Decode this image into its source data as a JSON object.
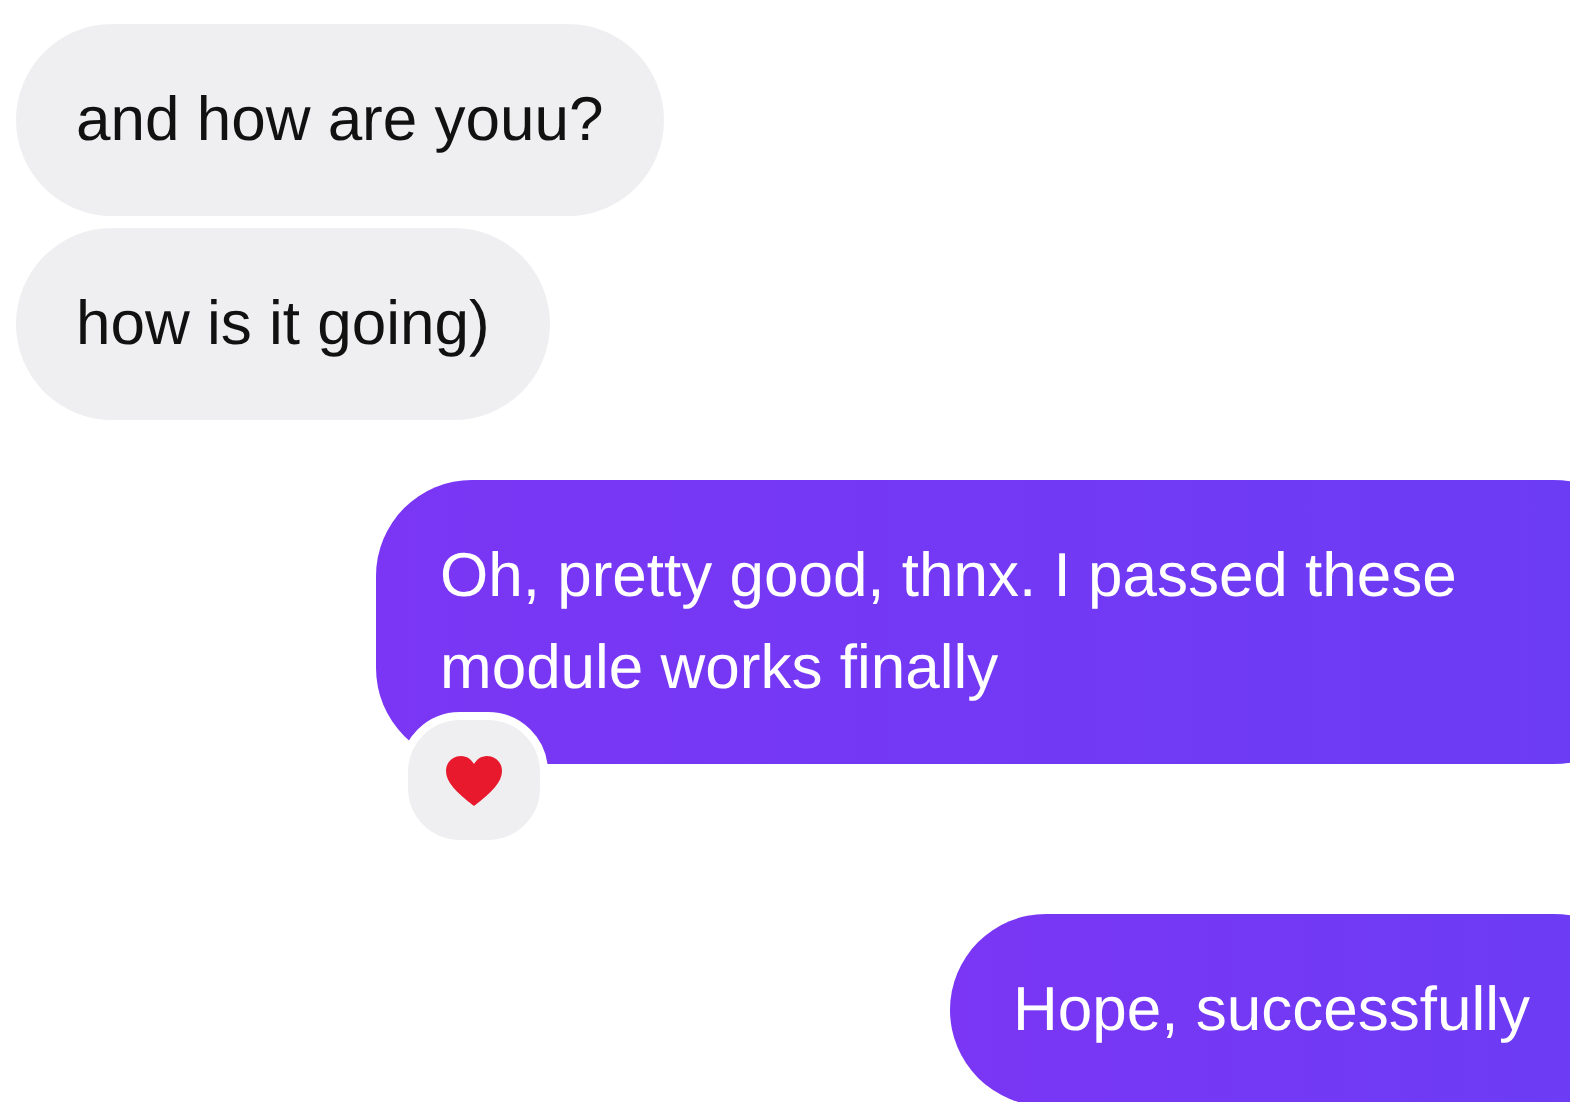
{
  "messages": [
    {
      "kind": "received",
      "text": "and how are youu?",
      "reacted": false
    },
    {
      "kind": "received",
      "text": "how is it going)",
      "reacted": false
    },
    {
      "kind": "sent",
      "text": "Oh, pretty good, thnx. I passed these module works finally",
      "reacted": true
    },
    {
      "kind": "sent",
      "text": "Hope, successfully",
      "reacted": false
    }
  ]
}
